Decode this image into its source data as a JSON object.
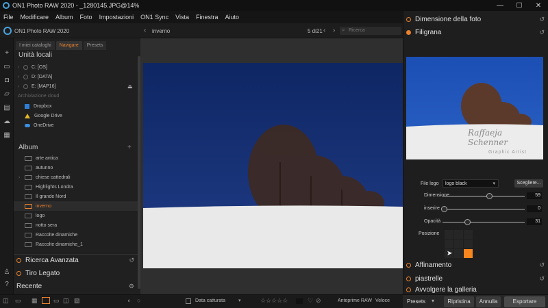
{
  "window": {
    "title": "ON1 Photo RAW 2020 - _1280145.JPG@14%"
  },
  "menu": [
    "File",
    "Modificare",
    "Album",
    "Foto",
    "Impostazioni",
    "ON1 Sync",
    "Vista",
    "Finestra",
    "Aiuto"
  ],
  "toolbar": {
    "app_label": "ON1 Photo RAW 2020",
    "breadcrumb": "inverno",
    "counter": "5 di21",
    "search_placeholder": "Ricerca"
  },
  "sidebar": {
    "tabs": [
      "I miei cataloghi",
      "Navigare",
      "Presets"
    ],
    "local_title": "Unità locali",
    "drives": [
      "C: [OS]",
      "D: [DATA]",
      "E: [MAP16]"
    ],
    "cloud_title": "Archiviazione cloud",
    "cloud": [
      "Dropbox",
      "Google Drive",
      "OneDrive"
    ],
    "album_title": "Album",
    "albums": [
      "arte antica",
      "autunno",
      "chiese cattedrali",
      "Highlights Londra",
      "Il grande Nord",
      "inverno",
      "logo",
      "notto sera",
      "Raccolte dinamiche",
      "Raccolte dinamiche_1"
    ],
    "selected_album": "inverno",
    "sections": [
      "Ricerca Avanzata",
      "Tiro Legato",
      "Recente"
    ]
  },
  "right": {
    "sections_top": [
      "Dimensione della foto",
      "Filigrana"
    ],
    "watermark_text": "Raffaeja Schenner",
    "watermark_sub": "Graphic Artist",
    "logo_file_label": "File logo",
    "logo_file_value": "logo black",
    "choose_button": "Scegliere...",
    "dimension_label": "Dimensione",
    "dimension_value": "59",
    "inset_label": "inserire",
    "inset_value": "0",
    "opacity_label": "Opacità",
    "opacity_value": "31",
    "position_label": "Posizione",
    "position_cell": 8,
    "sections_bottom": [
      "Affinamento",
      "piastrelle",
      "Avvolgere la galleria"
    ]
  },
  "bottom": {
    "sort_label": "Data catturata",
    "preview_label": "Anteprime RAW",
    "preview_mode": "Veloce"
  },
  "footer": {
    "presets": "Presets",
    "reset": "Ripristina",
    "cancel": "Annulla",
    "export": "Esportare"
  },
  "colors": {
    "accent": "#e8812f",
    "sky": "#0f2a6b",
    "snow": "#e9e9e9"
  }
}
